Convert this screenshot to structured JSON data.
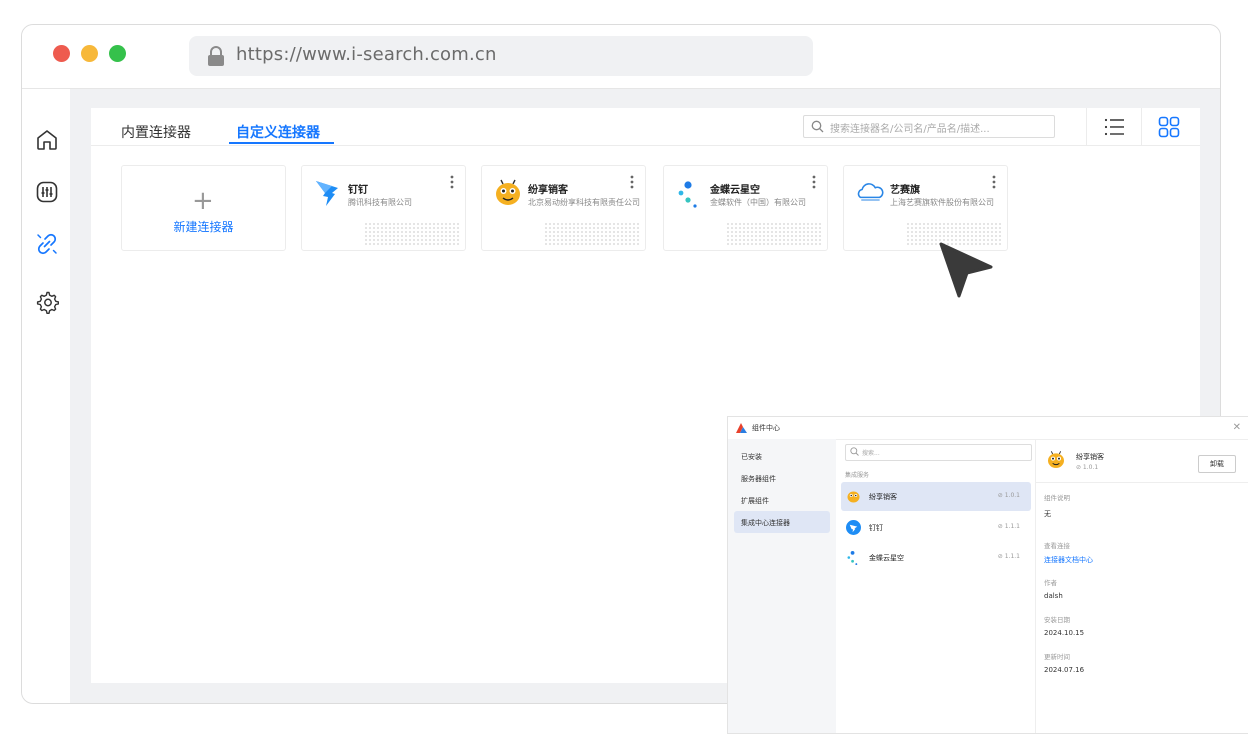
{
  "browser": {
    "url": "https://www.i-search.com.cn"
  },
  "rail": {
    "icons": [
      "home-icon",
      "sliders-icon",
      "link-icon",
      "gear-icon"
    ]
  },
  "main": {
    "tabs": [
      {
        "label": "内置连接器",
        "active": false
      },
      {
        "label": "自定义连接器",
        "active": true
      }
    ],
    "search_placeholder": "搜索连接器名/公司名/产品名/描述...",
    "new_connector_label": "新建连接器",
    "cards": [
      {
        "name": "钉钉",
        "company": "腾讯科技有限公司",
        "icon": "dingtalk-logo-icon"
      },
      {
        "name": "纷享销客",
        "company": "北京易动纷享科技有限责任公司",
        "icon": "fxiaoke-logo-icon"
      },
      {
        "name": "金蝶云星空",
        "company": "金蝶软件（中国）有限公司",
        "icon": "kingdee-logo-icon"
      },
      {
        "name": "艺赛旗",
        "company": "上海艺赛旗软件股份有限公司",
        "icon": "isearch-logo-icon"
      }
    ]
  },
  "overlay": {
    "title": "组件中心",
    "nav": [
      {
        "label": "已安装",
        "active": false
      },
      {
        "label": "服务器组件",
        "active": false
      },
      {
        "label": "扩展组件",
        "active": false
      },
      {
        "label": "集成中心连接器",
        "active": true
      }
    ],
    "search_placeholder": "搜索...",
    "group_label": "集成服务",
    "items": [
      {
        "name": "纷享销客",
        "version": "⊘ 1.0.1",
        "selected": true
      },
      {
        "name": "钉钉",
        "version": "⊘ 1.1.1",
        "selected": false
      },
      {
        "name": "金蝶云星空",
        "version": "⊘ 1.1.1",
        "selected": false
      }
    ],
    "detail": {
      "name": "纷享销客",
      "version": "⊘ 1.0.1",
      "uninstall_label": "卸载",
      "desc_label": "组件说明",
      "desc_value": "无",
      "link_label": "查看连接",
      "link_value": "连接器文档中心",
      "author_label": "作者",
      "author_value": "dalsh",
      "install_label": "安装日期",
      "install_value": "2024.10.15",
      "update_label": "更新时间",
      "update_value": "2024.07.16"
    }
  },
  "colors": {
    "accent": "#1677ff",
    "traffic_red": "#ee5b4f",
    "traffic_yellow": "#f7b83a",
    "traffic_green": "#35c14b"
  }
}
